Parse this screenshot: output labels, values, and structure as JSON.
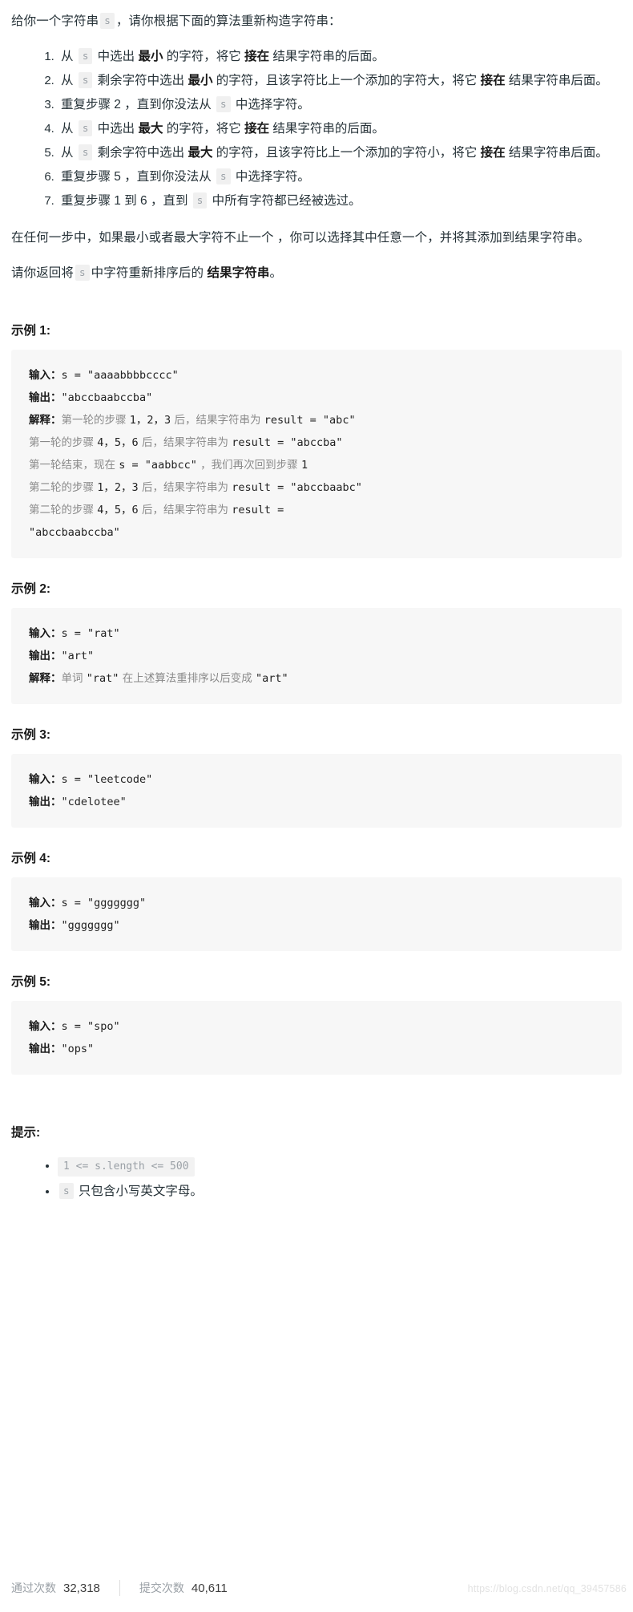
{
  "intro": {
    "prefix": "给你一个字符串",
    "var": "s",
    "suffix": "，请你根据下面的算法重新构造字符串："
  },
  "steps": [
    {
      "id": 1,
      "segments": [
        {
          "t": "text",
          "v": "从 "
        },
        {
          "t": "chip",
          "v": "s"
        },
        {
          "t": "text",
          "v": " 中选出 "
        },
        {
          "t": "bold",
          "v": "最小"
        },
        {
          "t": "text",
          "v": " 的字符，将它 "
        },
        {
          "t": "bold",
          "v": "接在"
        },
        {
          "t": "text",
          "v": " 结果字符串的后面。"
        }
      ]
    },
    {
      "id": 2,
      "segments": [
        {
          "t": "text",
          "v": "从 "
        },
        {
          "t": "chip",
          "v": "s"
        },
        {
          "t": "text",
          "v": " 剩余字符中选出 "
        },
        {
          "t": "bold",
          "v": "最小"
        },
        {
          "t": "text",
          "v": " 的字符，且该字符比上一个添加的字符大，将它 "
        },
        {
          "t": "bold",
          "v": "接在"
        },
        {
          "t": "text",
          "v": " 结果字符串后面。"
        }
      ]
    },
    {
      "id": 3,
      "segments": [
        {
          "t": "text",
          "v": "重复步骤 2 ，直到你没法从 "
        },
        {
          "t": "chip",
          "v": "s"
        },
        {
          "t": "text",
          "v": " 中选择字符。"
        }
      ]
    },
    {
      "id": 4,
      "segments": [
        {
          "t": "text",
          "v": "从 "
        },
        {
          "t": "chip",
          "v": "s"
        },
        {
          "t": "text",
          "v": " 中选出 "
        },
        {
          "t": "bold",
          "v": "最大"
        },
        {
          "t": "text",
          "v": " 的字符，将它 "
        },
        {
          "t": "bold",
          "v": "接在"
        },
        {
          "t": "text",
          "v": " 结果字符串的后面。"
        }
      ]
    },
    {
      "id": 5,
      "segments": [
        {
          "t": "text",
          "v": "从 "
        },
        {
          "t": "chip",
          "v": "s"
        },
        {
          "t": "text",
          "v": " 剩余字符中选出 "
        },
        {
          "t": "bold",
          "v": "最大"
        },
        {
          "t": "text",
          "v": " 的字符，且该字符比上一个添加的字符小，将它 "
        },
        {
          "t": "bold",
          "v": "接在"
        },
        {
          "t": "text",
          "v": " 结果字符串后面。"
        }
      ]
    },
    {
      "id": 6,
      "segments": [
        {
          "t": "text",
          "v": "重复步骤 5 ，直到你没法从 "
        },
        {
          "t": "chip",
          "v": "s"
        },
        {
          "t": "text",
          "v": " 中选择字符。"
        }
      ]
    },
    {
      "id": 7,
      "segments": [
        {
          "t": "text",
          "v": "重复步骤 1 到 6 ，直到 "
        },
        {
          "t": "chip",
          "v": "s"
        },
        {
          "t": "text",
          "v": " 中所有字符都已经被选过。"
        }
      ]
    }
  ],
  "note": "在任何一步中，如果最小或者最大字符不止一个 ，你可以选择其中任意一个，并将其添加到结果字符串。",
  "return_line": {
    "prefix": "请你返回将",
    "var": "s",
    "middle": "中字符重新排序后的",
    "bold": "结果字符串",
    "suffix": "。"
  },
  "examples": [
    {
      "heading": "示例 1:",
      "lines": [
        [
          {
            "t": "lbl",
            "v": "输入："
          },
          {
            "t": "mono",
            "v": "s = \"aaaabbbbcccc\""
          }
        ],
        [
          {
            "t": "lbl",
            "v": "输出："
          },
          {
            "t": "mono",
            "v": "\"abccbaabccba\""
          }
        ],
        [
          {
            "t": "lbl",
            "v": "解释："
          },
          {
            "t": "cn",
            "v": "第一轮的步骤 "
          },
          {
            "t": "mono",
            "v": "1，2，3"
          },
          {
            "t": "cn",
            "v": " 后，结果字符串为 "
          },
          {
            "t": "mono",
            "v": "result = \"abc\""
          }
        ],
        [
          {
            "t": "cn",
            "v": "第一轮的步骤 "
          },
          {
            "t": "mono",
            "v": "4，5，6"
          },
          {
            "t": "cn",
            "v": " 后，结果字符串为 "
          },
          {
            "t": "mono",
            "v": "result = \"abccba\""
          }
        ],
        [
          {
            "t": "cn",
            "v": "第一轮结束，现在 "
          },
          {
            "t": "mono",
            "v": "s = \"aabbcc\""
          },
          {
            "t": "cn",
            "v": " ，我们再次回到步骤 "
          },
          {
            "t": "mono",
            "v": "1"
          }
        ],
        [
          {
            "t": "cn",
            "v": "第二轮的步骤 "
          },
          {
            "t": "mono",
            "v": "1，2，3"
          },
          {
            "t": "cn",
            "v": " 后，结果字符串为 "
          },
          {
            "t": "mono",
            "v": "result = \"abccbaabc\""
          }
        ],
        [
          {
            "t": "cn",
            "v": "第二轮的步骤 "
          },
          {
            "t": "mono",
            "v": "4，5，6"
          },
          {
            "t": "cn",
            "v": " 后，结果字符串为 "
          },
          {
            "t": "mono",
            "v": "result = "
          }
        ],
        [
          {
            "t": "mono",
            "v": "\"abccbaabccba\""
          }
        ]
      ]
    },
    {
      "heading": "示例 2:",
      "lines": [
        [
          {
            "t": "lbl",
            "v": "输入："
          },
          {
            "t": "mono",
            "v": "s = \"rat\""
          }
        ],
        [
          {
            "t": "lbl",
            "v": "输出："
          },
          {
            "t": "mono",
            "v": "\"art\""
          }
        ],
        [
          {
            "t": "lbl",
            "v": "解释："
          },
          {
            "t": "cn",
            "v": "单词 "
          },
          {
            "t": "mono",
            "v": "\"rat\""
          },
          {
            "t": "cn",
            "v": " 在上述算法重排序以后变成 "
          },
          {
            "t": "mono",
            "v": "\"art\""
          }
        ]
      ]
    },
    {
      "heading": "示例 3:",
      "lines": [
        [
          {
            "t": "lbl",
            "v": "输入："
          },
          {
            "t": "mono",
            "v": "s = \"leetcode\""
          }
        ],
        [
          {
            "t": "lbl",
            "v": "输出："
          },
          {
            "t": "mono",
            "v": "\"cdelotee\""
          }
        ]
      ]
    },
    {
      "heading": "示例 4:",
      "lines": [
        [
          {
            "t": "lbl",
            "v": "输入："
          },
          {
            "t": "mono",
            "v": "s = \"ggggggg\""
          }
        ],
        [
          {
            "t": "lbl",
            "v": "输出："
          },
          {
            "t": "mono",
            "v": "\"ggggggg\""
          }
        ]
      ]
    },
    {
      "heading": "示例 5:",
      "lines": [
        [
          {
            "t": "lbl",
            "v": "输入："
          },
          {
            "t": "mono",
            "v": "s = \"spo\""
          }
        ],
        [
          {
            "t": "lbl",
            "v": "输出："
          },
          {
            "t": "mono",
            "v": "\"ops\""
          }
        ]
      ]
    }
  ],
  "hints": {
    "heading": "提示:",
    "items": [
      [
        {
          "t": "chipwide",
          "v": "1 <= s.length <= 500"
        }
      ],
      [
        {
          "t": "chip",
          "v": "s"
        },
        {
          "t": "text",
          "v": " 只包含小写英文字母。"
        }
      ]
    ]
  },
  "footer": {
    "accepted_label": "通过次数",
    "accepted_value": "32,318",
    "submissions_label": "提交次数",
    "submissions_value": "40,611",
    "watermark": "https://blog.csdn.net/qq_39457586"
  },
  "colors": {
    "text": "#263238",
    "chip_bg": "#f0f0f0",
    "chip_fg": "#9aa0a6",
    "block_bg": "#f7f7f7",
    "muted": "#8a8a8a",
    "watermark": "#e2e2e2"
  }
}
